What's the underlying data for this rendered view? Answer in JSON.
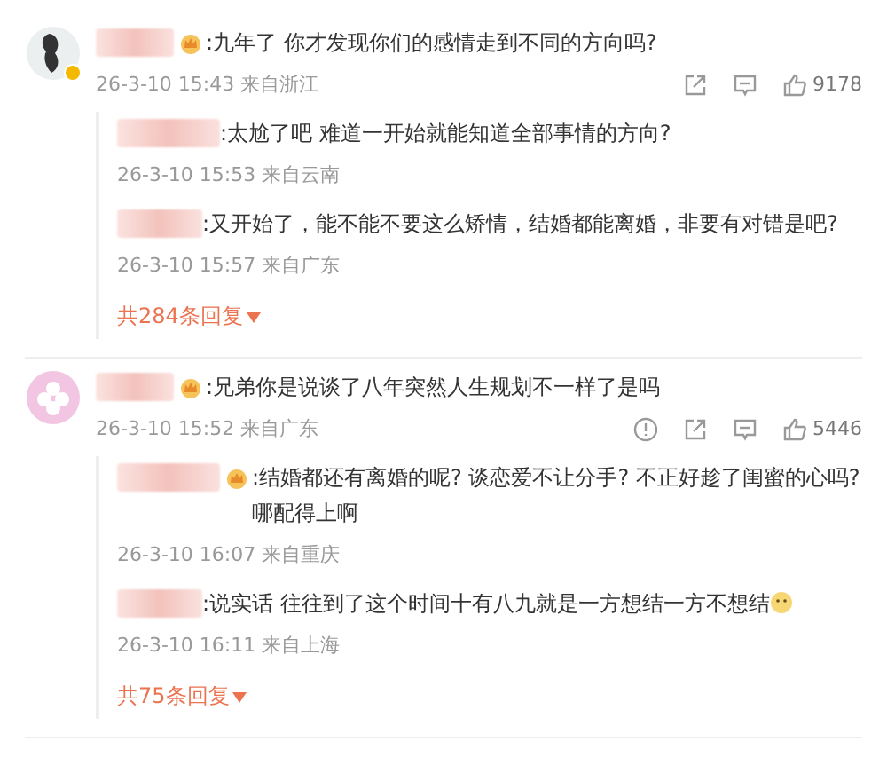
{
  "comments": [
    {
      "avatar": {
        "kind": "figure",
        "verified": true
      },
      "badge": true,
      "text": ":九年了 你才发现你们的感情走到不同的方向吗?",
      "time": "26-3-10 15:43 来自浙江",
      "report": false,
      "likes": "9178",
      "replies": [
        {
          "badge": false,
          "emoji": false,
          "text": ":太尬了吧 难道一开始就能知道全部事情的方向?",
          "time": "26-3-10 15:53 来自云南"
        },
        {
          "badge": false,
          "emoji": false,
          "text": ":又开始了，能不能不要这么矫情，结婚都能离婚，非要有对错是吧?",
          "time": "26-3-10 15:57 来自广东"
        }
      ],
      "more": "共284条回复"
    },
    {
      "avatar": {
        "kind": "flower",
        "verified": false
      },
      "badge": true,
      "text": ":兄弟你是说谈了八年突然人生规划不一样了是吗",
      "time": "26-3-10 15:52 来自广东",
      "report": true,
      "likes": "5446",
      "replies": [
        {
          "badge": true,
          "emoji": false,
          "text": ":结婚都还有离婚的呢? 谈恋爱不让分手? 不正好趁了闺蜜的心吗? 哪配得上啊",
          "time": "26-3-10 16:07 来自重庆"
        },
        {
          "badge": false,
          "emoji": true,
          "text": ":说实话 往往到了这个时间十有八九就是一方想结一方不想结",
          "time": "26-3-10 16:11 来自上海"
        }
      ],
      "more": "共75条回复"
    }
  ]
}
